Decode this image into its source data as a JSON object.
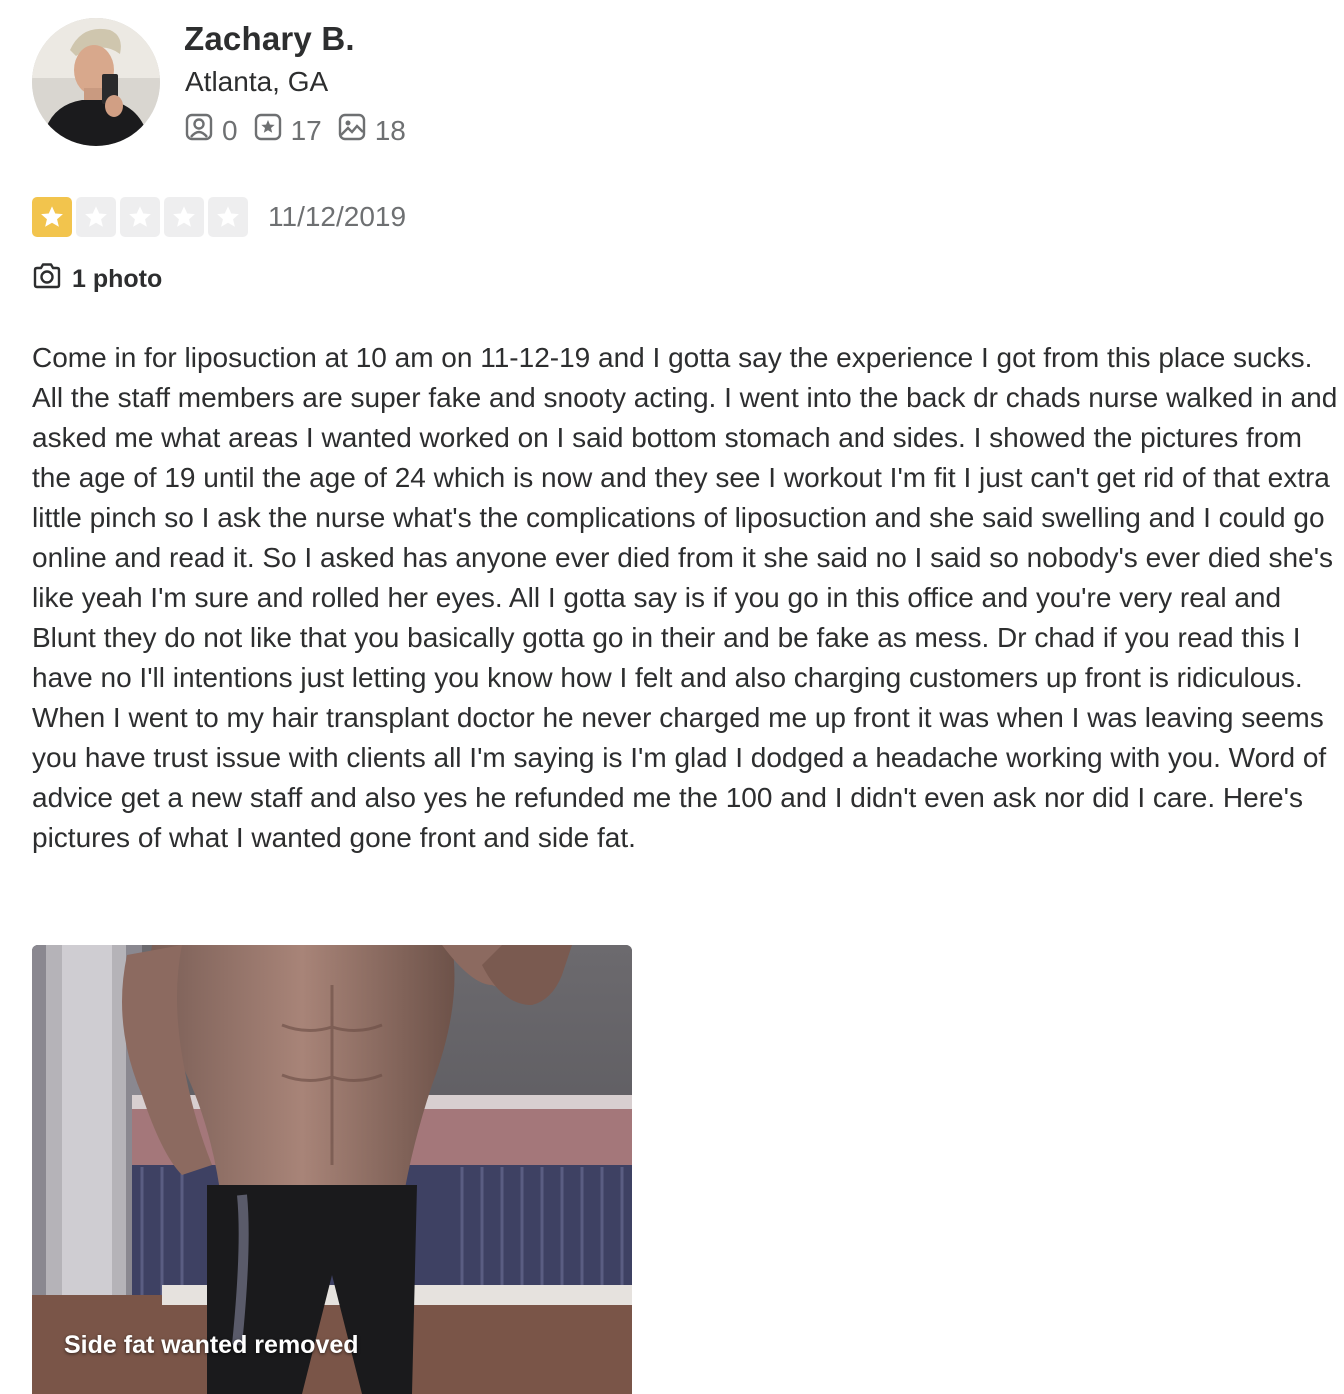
{
  "reviewer": {
    "name": "Zachary B.",
    "location": "Atlanta, GA",
    "stats": {
      "friends": "0",
      "reviews": "17",
      "photos": "18"
    }
  },
  "review": {
    "rating": 1,
    "rating_max": 5,
    "date": "11/12/2019",
    "photo_count_label": "1 photo",
    "text": "Come in for liposuction at 10 am on 11-12-19 and I gotta say the experience I got from this place sucks. All the staff members are super fake and snooty acting. I went into the back dr chads nurse walked in and asked me what areas I wanted worked on I said bottom stomach and sides. I showed the pictures from the age of 19 until the age of 24 which is now and they see I workout I'm fit I just can't get rid of that extra little pinch so I ask the nurse what's the complications of liposuction and she said swelling and I could go online and read it. So I asked has anyone ever died from it she said no I said so nobody's ever died she's like yeah I'm sure and rolled her eyes. All I gotta say is if you go in this office and you're very real and Blunt they do not like that you basically gotta go in their and be fake as mess. Dr chad if you read this I have no I'll intentions just letting you know how I felt and also charging customers up front is ridiculous. When I went to my hair transplant doctor he never charged me up front it was when I was leaving seems you have trust issue with clients all I'm saying is I'm glad I dodged a headache working with you. Word of advice get a new staff and also yes he refunded me the 100 and I didn't even ask nor did I care. Here's pictures of what I wanted gone front and side fat."
  },
  "photo": {
    "caption": "Side fat wanted removed"
  },
  "colors": {
    "star_filled": "#f2c44d",
    "star_empty": "#eeeeef",
    "text_primary": "#2d2e2f",
    "text_secondary": "#6e7072"
  },
  "icons": {
    "friends": "friends-icon",
    "reviews": "review-star-icon",
    "photos": "photo-icon",
    "camera": "camera-icon"
  }
}
